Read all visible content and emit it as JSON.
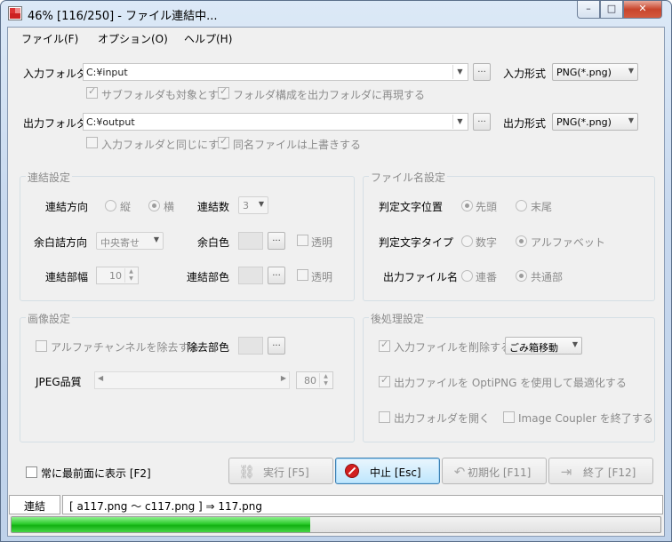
{
  "window": {
    "title": "46% [116/250] - ファイル連結中..."
  },
  "caption_buttons": {
    "minimize": "–",
    "maximize": "□",
    "close": "✕"
  },
  "menu": [
    "ファイル(F)",
    "オプション(O)",
    "ヘルプ(H)"
  ],
  "input": {
    "label": "入力フォルダ",
    "path": "C:¥input",
    "format_label": "入力形式",
    "format": "PNG(*.png)",
    "include_subfolders": "サブフォルダも対象とする",
    "include_subfolders_checked": true,
    "reproduce_structure": "フォルダ構成を出力フォルダに再現する",
    "reproduce_structure_checked": true
  },
  "output": {
    "label": "出力フォルダ",
    "path": "C:¥output",
    "format_label": "出力形式",
    "format": "PNG(*.png)",
    "same_as_input": "入力フォルダと同じにする",
    "same_as_input_checked": false,
    "overwrite": "同名ファイルは上書きする",
    "overwrite_checked": true
  },
  "browse_label": "...",
  "concat": {
    "title": "連結設定",
    "direction_label": "連結方向",
    "vertical": "縦",
    "horizontal": "横",
    "direction": "horizontal",
    "count_label": "連結数",
    "count": "3",
    "trim_label": "余白詰方向",
    "trim": "中央寄せ",
    "margin_color_label": "余白色",
    "transparent": "透明",
    "gap_width_label": "連結部幅",
    "gap_width": "10",
    "gap_color_label": "連結部色"
  },
  "filename": {
    "title": "ファイル名設定",
    "position_label": "判定文字位置",
    "head": "先頭",
    "tail": "末尾",
    "position": "head",
    "type_label": "判定文字タイプ",
    "digits": "数字",
    "alphabet": "アルファベット",
    "type": "alphabet",
    "output_name_label": "出力ファイル名",
    "sequential": "連番",
    "common": "共通部",
    "output_name": "common"
  },
  "image": {
    "title": "画像設定",
    "remove_alpha": "アルファチャンネルを除去する",
    "remove_color_label": "除去部色",
    "jpeg_label": "JPEG品質",
    "jpeg_quality": "80"
  },
  "post": {
    "title": "後処理設定",
    "delete_input": "入力ファイルを削除する",
    "delete_input_checked": true,
    "delete_mode": "ごみ箱移動",
    "optipng": "出力ファイルを OptiPNG を使用して最適化する",
    "optipng_checked": true,
    "open_folder": "出力フォルダを開く",
    "open_folder_checked": false,
    "quit_app": "Image Coupler を終了する",
    "quit_app_checked": false
  },
  "always_on_top": "常に最前面に表示 [F2]",
  "buttons": {
    "run": "実行 [F5]",
    "stop": "中止 [Esc]",
    "reset": "初期化 [F11]",
    "exit": "終了 [F12]"
  },
  "status": {
    "mode": "連結",
    "message": "[ a117.png ～ c117.png ] ⇒ 117.png"
  },
  "progress_fraction": 0.46
}
